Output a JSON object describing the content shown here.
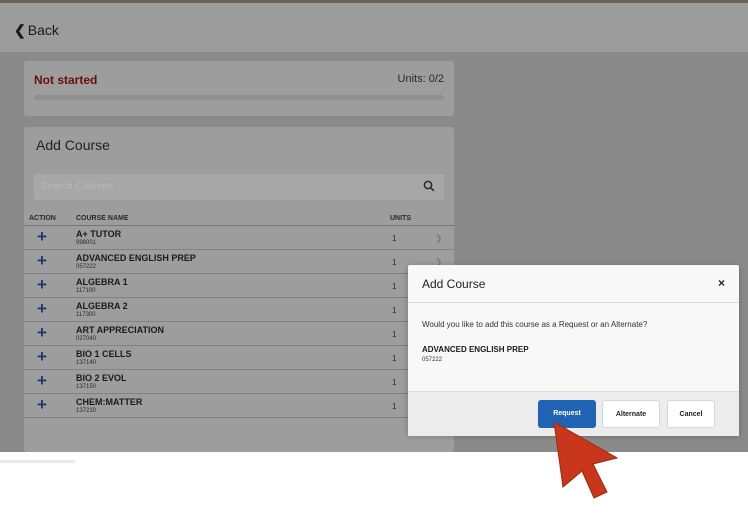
{
  "header": {
    "back_label": "Back"
  },
  "status": {
    "text": "Not started",
    "units": "Units: 0/2",
    "progress": 0
  },
  "add_course": {
    "title": "Add Course",
    "search_placeholder": "Search Courses",
    "columns": {
      "action": "ACTION",
      "name": "COURSE NAME",
      "units": "UNITS"
    },
    "rows": [
      {
        "name": "A+ TUTOR",
        "code": "998001",
        "units": "1"
      },
      {
        "name": "ADVANCED ENGLISH PREP",
        "code": "057222",
        "units": "1"
      },
      {
        "name": "ALGEBRA 1",
        "code": "117100",
        "units": "1"
      },
      {
        "name": "ALGEBRA 2",
        "code": "117300",
        "units": "1"
      },
      {
        "name": "ART APPRECIATION",
        "code": "027040",
        "units": "1"
      },
      {
        "name": "BIO 1 CELLS",
        "code": "137140",
        "units": "1"
      },
      {
        "name": "BIO 2 EVOL",
        "code": "137150",
        "units": "1"
      },
      {
        "name": "CHEM:MATTER",
        "code": "137210",
        "units": "1"
      }
    ]
  },
  "modal": {
    "title": "Add Course",
    "close": "×",
    "question": "Would you like to add this course as a Request or an Alternate?",
    "course_name": "ADVANCED ENGLISH PREP",
    "course_code": "057222",
    "buttons": {
      "request": "Request",
      "alternate": "Alternate",
      "cancel": "Cancel"
    }
  },
  "colors": {
    "primary": "#1e63b4",
    "status": "#6b0e0e",
    "cursor": "#c8371b"
  }
}
